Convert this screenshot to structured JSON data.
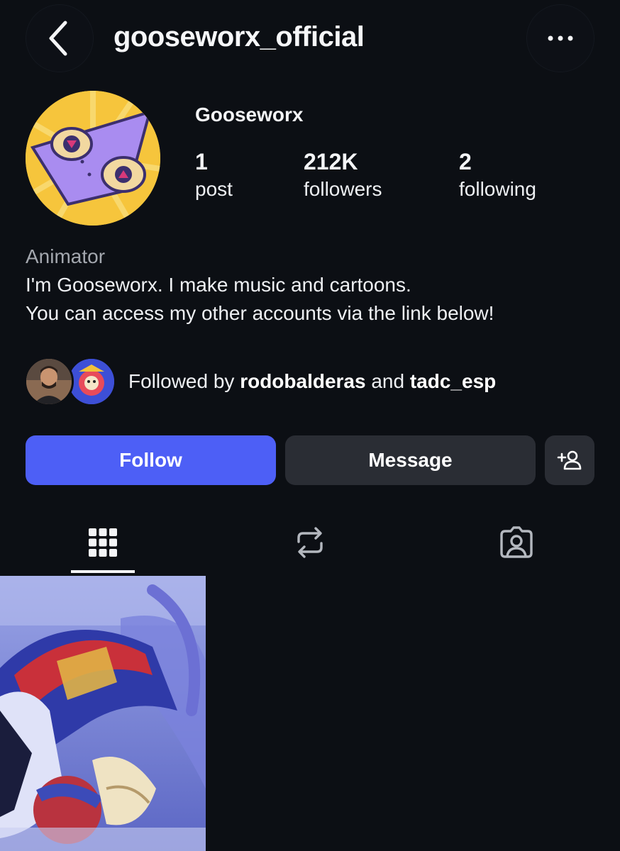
{
  "header": {
    "username": "gooseworx_official",
    "back_icon": "chevron-left-icon",
    "more_icon": "more-horizontal-icon"
  },
  "profile": {
    "display_name": "Gooseworx",
    "stats": [
      {
        "value": "1",
        "label": "post"
      },
      {
        "value": "212K",
        "label": "followers"
      },
      {
        "value": "2",
        "label": "following"
      }
    ],
    "bio": {
      "category": "Animator",
      "line1": "I'm Gooseworx. I make music and cartoons.",
      "line2": "You can access my other accounts via the link below!"
    },
    "followed_by": {
      "prefix": "Followed by ",
      "user1": "rodobalderas",
      "conjunction": " and ",
      "user2": "tadc_esp"
    }
  },
  "actions": {
    "follow_label": "Follow",
    "message_label": "Message",
    "add_icon": "add-person-icon"
  },
  "tabs": [
    {
      "name": "grid",
      "icon": "grid-icon",
      "active": true
    },
    {
      "name": "reposts",
      "icon": "repost-icon",
      "active": false
    },
    {
      "name": "tagged",
      "icon": "tagged-person-icon",
      "active": false
    }
  ],
  "colors": {
    "background": "#0c0f14",
    "follow_button": "#4d5ff6",
    "secondary_button": "#2a2d34",
    "muted_text": "#a3a7ae"
  }
}
